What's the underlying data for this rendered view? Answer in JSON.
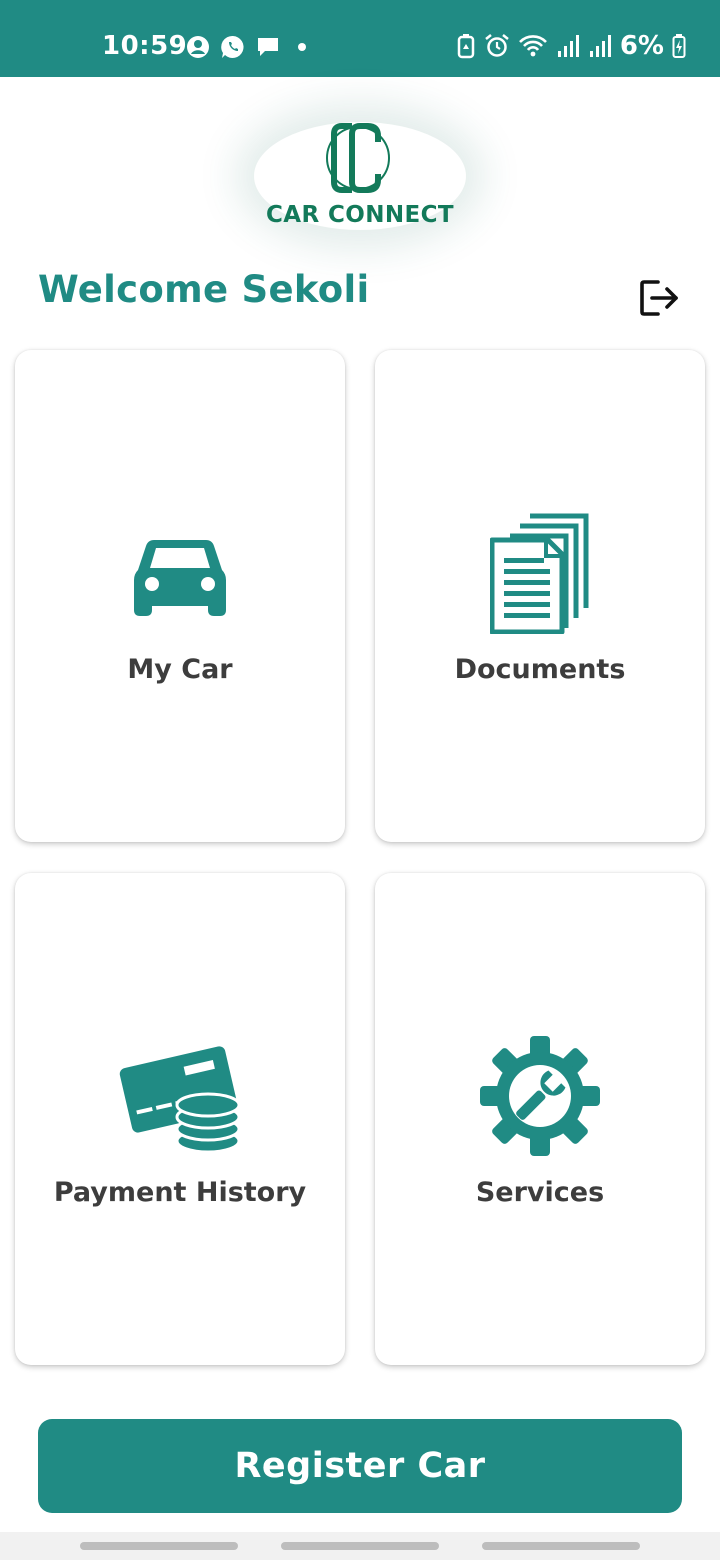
{
  "status_bar": {
    "time": "10:59",
    "battery": "6%",
    "left_icons": [
      "account-icon",
      "whatsapp-icon",
      "message-icon",
      "dot-icon"
    ],
    "right_icons": [
      "battery-saver-icon",
      "alarm-icon",
      "wifi-icon",
      "signal-icon",
      "signal-icon",
      "battery-charging-icon"
    ]
  },
  "logo": {
    "text": "CAR CONNECT"
  },
  "header": {
    "welcome": "Welcome Sekoli",
    "logout_icon": "logout-icon"
  },
  "cards": [
    {
      "label": "My Car",
      "icon": "car-icon"
    },
    {
      "label": "Documents",
      "icon": "documents-icon"
    },
    {
      "label": "Payment History",
      "icon": "payment-icon"
    },
    {
      "label": "Services",
      "icon": "settings-wrench-icon"
    }
  ],
  "register": {
    "label": "Register Car"
  },
  "colors": {
    "primary": "#208b84",
    "logo": "#137a5a",
    "card_text": "#3d3d3d"
  }
}
